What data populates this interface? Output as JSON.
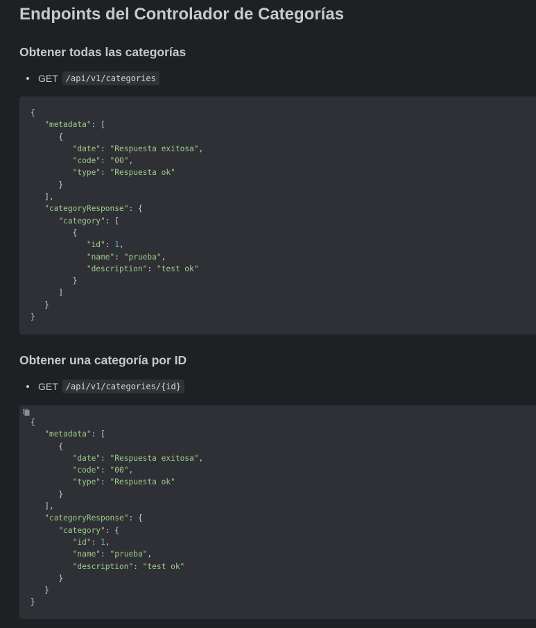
{
  "page": {
    "title": "Endpoints del Controlador de Categorías"
  },
  "sections": [
    {
      "heading": "Obtener todas las categorías",
      "method": "GET",
      "path": "/api/v1/categories",
      "response": [
        "{",
        "   \"metadata\": [",
        "      {",
        "         \"date\": \"Respuesta exitosa\",",
        "         \"code\": \"00\",",
        "         \"type\": \"Respuesta ok\"",
        "      }",
        "   ],",
        "   \"categoryResponse\": {",
        "      \"category\": [",
        "         {",
        "            \"id\": 1,",
        "            \"name\": \"prueba\",",
        "            \"description\": \"test ok\"",
        "         }",
        "      ]",
        "   }",
        "}"
      ]
    },
    {
      "heading": "Obtener una categoría por ID",
      "method": "GET",
      "path": "/api/v1/categories/{id}",
      "response": [
        "{",
        "   \"metadata\": [",
        "      {",
        "         \"date\": \"Respuesta exitosa\",",
        "         \"code\": \"00\",",
        "         \"type\": \"Respuesta ok\"",
        "      }",
        "   ],",
        "   \"categoryResponse\": {",
        "      \"category\": {",
        "         \"id\": 1,",
        "         \"name\": \"prueba\",",
        "         \"description\": \"test ok\"",
        "      }",
        "   }",
        "}"
      ]
    }
  ],
  "icons": {
    "copy": "copy-icon"
  },
  "colors": {
    "background": "#1f2023",
    "code_background": "#2f3035",
    "string": "#9ccc8a",
    "number": "#53b9d8",
    "text": "#c9cbd0"
  }
}
